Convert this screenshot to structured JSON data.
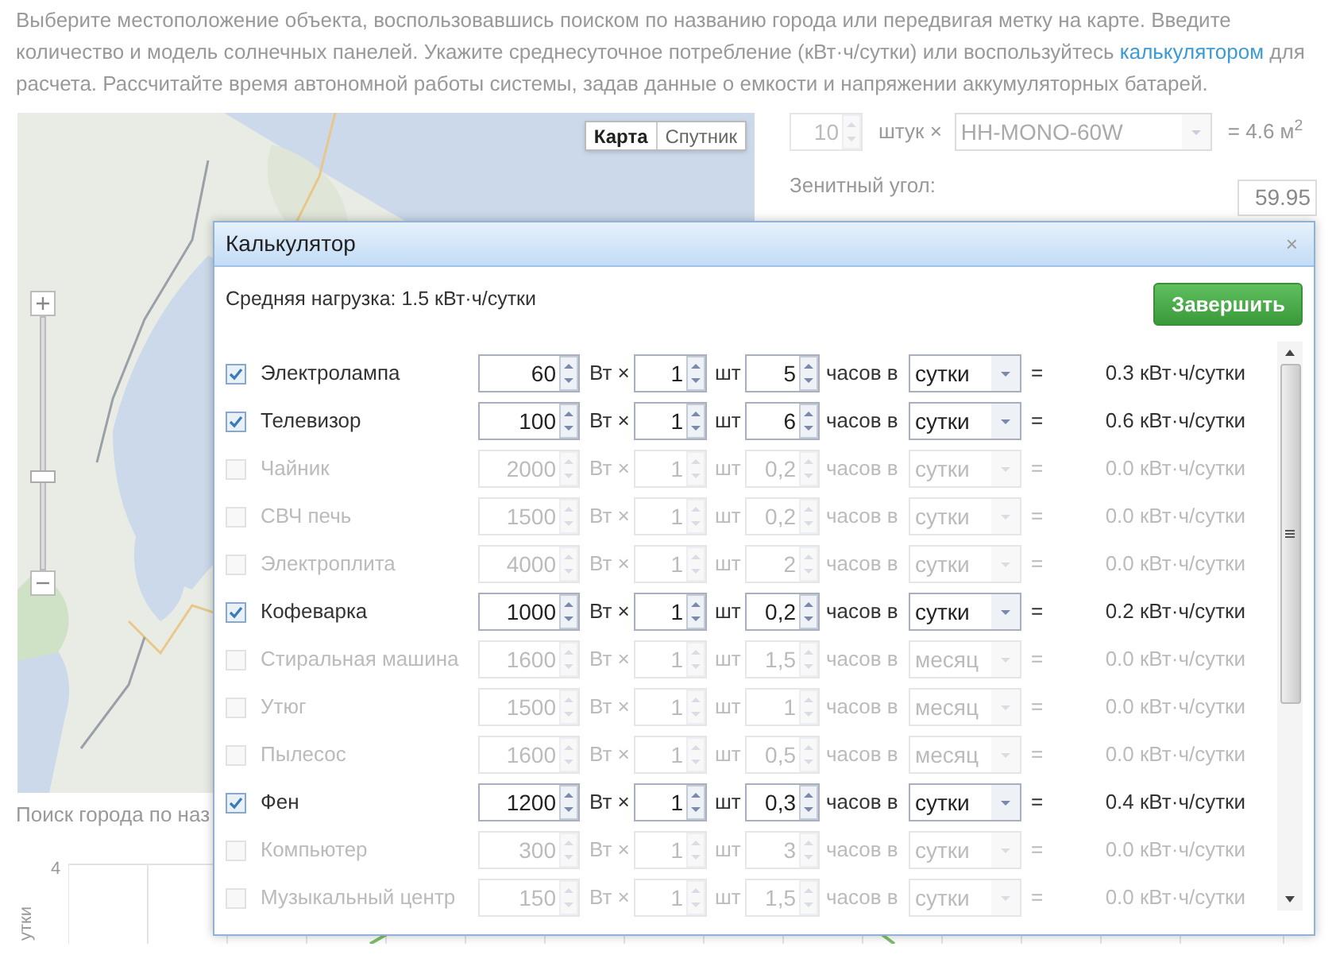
{
  "intro": {
    "before": "Выберите местоположение объекта, воспользовавшись поиском по названию города или передвигая метку на карте. Введите количество и модель солнечных панелей. Укажите среднесуточное потребление (кВт·ч/сутки) или воспользуйтесь ",
    "link": "калькулятором",
    "after": " для расчета. Рассчитайте время автономной работы системы, задав данные о емкости и напряжении аккумуляторных батарей."
  },
  "map": {
    "zoom": {
      "level": 0.36
    },
    "map_types": [
      {
        "label": "Карта",
        "selected": true
      },
      {
        "label": "Спутник",
        "selected": false
      }
    ]
  },
  "panels": {
    "count": "10",
    "unit": "штук ×",
    "model": "HH-MONO-60W",
    "area": "= 4.6 м$^{2}$"
  },
  "zenith": {
    "label": "Зенитный угол:",
    "value": "59.95"
  },
  "city_search": {
    "label": "Поиск города по наз"
  },
  "background_chart": {
    "y_tick": "4",
    "y_label": "утки"
  },
  "dialog": {
    "title": "Калькулятор",
    "close": "×",
    "load": "Средняя нагрузка: 1.5 кВт·ч/сутки",
    "finish_button": "Завершить",
    "rows": [
      {
        "name": "Электролампа",
        "checked": true,
        "watts": "60",
        "watt_unit": "Вт ×",
        "count": "1",
        "count_unit": "шт",
        "hours": "5",
        "hours_unit": "часов в",
        "period": "сутки",
        "equals": "=",
        "result": "0.3 кВт·ч/сутки"
      },
      {
        "name": "Телевизор",
        "checked": true,
        "watts": "100",
        "watt_unit": "Вт ×",
        "count": "1",
        "count_unit": "шт",
        "hours": "6",
        "hours_unit": "часов в",
        "period": "сутки",
        "equals": "=",
        "result": "0.6 кВт·ч/сутки"
      },
      {
        "name": "Чайник",
        "checked": false,
        "watts": "2000",
        "watt_unit": "Вт ×",
        "count": "1",
        "count_unit": "шт",
        "hours": "0,2",
        "hours_unit": "часов в",
        "period": "сутки",
        "equals": "=",
        "result": "0.0 кВт·ч/сутки"
      },
      {
        "name": "СВЧ печь",
        "checked": false,
        "watts": "1500",
        "watt_unit": "Вт ×",
        "count": "1",
        "count_unit": "шт",
        "hours": "0,2",
        "hours_unit": "часов в",
        "period": "сутки",
        "equals": "=",
        "result": "0.0 кВт·ч/сутки"
      },
      {
        "name": "Электроплита",
        "checked": false,
        "watts": "4000",
        "watt_unit": "Вт ×",
        "count": "1",
        "count_unit": "шт",
        "hours": "2",
        "hours_unit": "часов в",
        "period": "сутки",
        "equals": "=",
        "result": "0.0 кВт·ч/сутки"
      },
      {
        "name": "Кофеварка",
        "checked": true,
        "watts": "1000",
        "watt_unit": "Вт ×",
        "count": "1",
        "count_unit": "шт",
        "hours": "0,2",
        "hours_unit": "часов в",
        "period": "сутки",
        "equals": "=",
        "result": "0.2 кВт·ч/сутки"
      },
      {
        "name": "Стиральная машина",
        "checked": false,
        "watts": "1600",
        "watt_unit": "Вт ×",
        "count": "1",
        "count_unit": "шт",
        "hours": "1,5",
        "hours_unit": "часов в",
        "period": "месяц",
        "equals": "=",
        "result": "0.0 кВт·ч/сутки"
      },
      {
        "name": "Утюг",
        "checked": false,
        "watts": "1500",
        "watt_unit": "Вт ×",
        "count": "1",
        "count_unit": "шт",
        "hours": "1",
        "hours_unit": "часов в",
        "period": "месяц",
        "equals": "=",
        "result": "0.0 кВт·ч/сутки"
      },
      {
        "name": "Пылесос",
        "checked": false,
        "watts": "1600",
        "watt_unit": "Вт ×",
        "count": "1",
        "count_unit": "шт",
        "hours": "0,5",
        "hours_unit": "часов в",
        "period": "месяц",
        "equals": "=",
        "result": "0.0 кВт·ч/сутки"
      },
      {
        "name": "Фен",
        "checked": true,
        "watts": "1200",
        "watt_unit": "Вт ×",
        "count": "1",
        "count_unit": "шт",
        "hours": "0,3",
        "hours_unit": "часов в",
        "period": "сутки",
        "equals": "=",
        "result": "0.4 кВт·ч/сутки"
      },
      {
        "name": "Компьютер",
        "checked": false,
        "watts": "300",
        "watt_unit": "Вт ×",
        "count": "1",
        "count_unit": "шт",
        "hours": "3",
        "hours_unit": "часов в",
        "period": "сутки",
        "equals": "=",
        "result": "0.0 кВт·ч/сутки"
      },
      {
        "name": "Музыкальный центр",
        "checked": false,
        "watts": "150",
        "watt_unit": "Вт ×",
        "count": "1",
        "count_unit": "шт",
        "hours": "1,5",
        "hours_unit": "часов в",
        "period": "сутки",
        "equals": "=",
        "result": "0.0 кВт·ч/сутки"
      }
    ]
  }
}
